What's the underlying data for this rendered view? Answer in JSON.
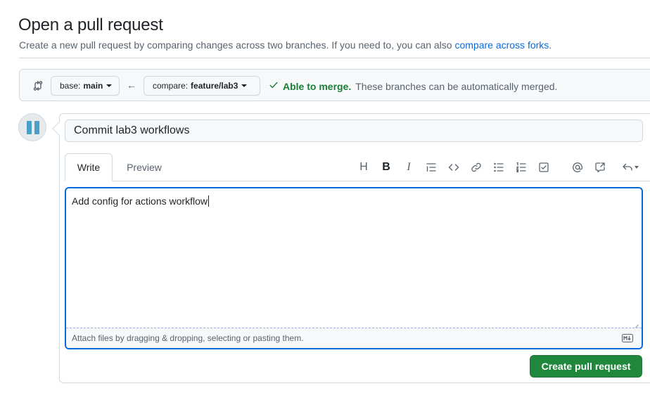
{
  "header": {
    "title": "Open a pull request",
    "subtitle_prefix": "Create a new pull request by comparing changes across two branches. If you need to, you can also ",
    "subtitle_link": "compare across forks",
    "subtitle_suffix": "."
  },
  "compare": {
    "base_prefix": "base:",
    "base_branch": "main",
    "compare_prefix": "compare:",
    "compare_branch": "feature/lab3",
    "status_ok": "Able to merge.",
    "status_text": "These branches can be automatically merged."
  },
  "form": {
    "title_value": "Commit lab3 workflows",
    "tabs": {
      "write": "Write",
      "preview": "Preview"
    },
    "toolbar": {
      "heading": "H",
      "bold": "B",
      "italic": "I"
    },
    "body_value": "Add config for actions workflow",
    "attach_hint": "Attach files by dragging & dropping, selecting or pasting them.",
    "submit_label": "Create pull request"
  },
  "icons": {
    "compare": "git-compare-icon",
    "arrow": "arrow-left-icon",
    "check": "check-icon",
    "markdown": "markdown-icon"
  },
  "colors": {
    "accent": "#0969da",
    "success": "#1a7f37",
    "primary_button": "#1f883d",
    "border": "#d1d9e0",
    "muted_bg": "#f6f8fa"
  }
}
